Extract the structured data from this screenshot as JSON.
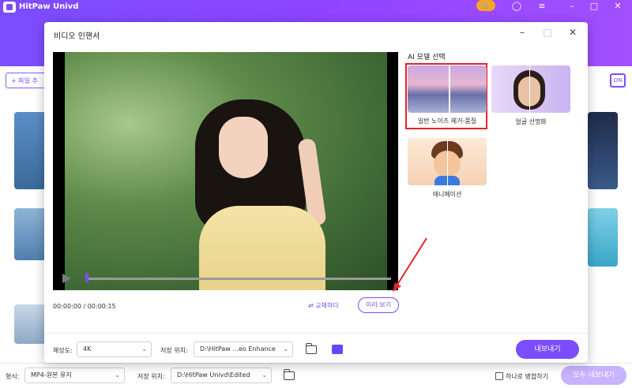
{
  "app": {
    "title": "HitPaw Univd",
    "accent": "#7b4dff"
  },
  "header": {
    "icons": [
      "cart-icon",
      "user-icon",
      "menu-icon",
      "minimize-icon",
      "maximize-icon",
      "close-icon"
    ]
  },
  "left_panel": {
    "add_file_label": "+ 파일 추"
  },
  "dialog": {
    "title": "비디오 인핸서",
    "ai_model_title": "AI 모델 선택",
    "models": [
      {
        "label": "일반 노이즈 제거-품질",
        "selected": true
      },
      {
        "label": "얼굴 선명화",
        "selected": false
      },
      {
        "label": "애니메이션",
        "selected": false
      }
    ],
    "time_display": "00:00:00 / 00:00:15",
    "swap_label": "교체하다",
    "preview_label": "미리 보기",
    "resolution_label": "해상도:",
    "resolution_value": "4K",
    "save_location_label": "저장 위치:",
    "save_location_value": "D:\\HitPaw ...eo Enhance",
    "export_label": "내보내기"
  },
  "bottom_bar": {
    "format_label": "형식:",
    "format_value": "MP4-원본 유지",
    "save_location_label": "저장 위치:",
    "save_location_value": "D:\\HitPaw Univd\\Edited",
    "merge_label": "하나로 병합하기",
    "export_all_label": "모두 내보내기"
  }
}
